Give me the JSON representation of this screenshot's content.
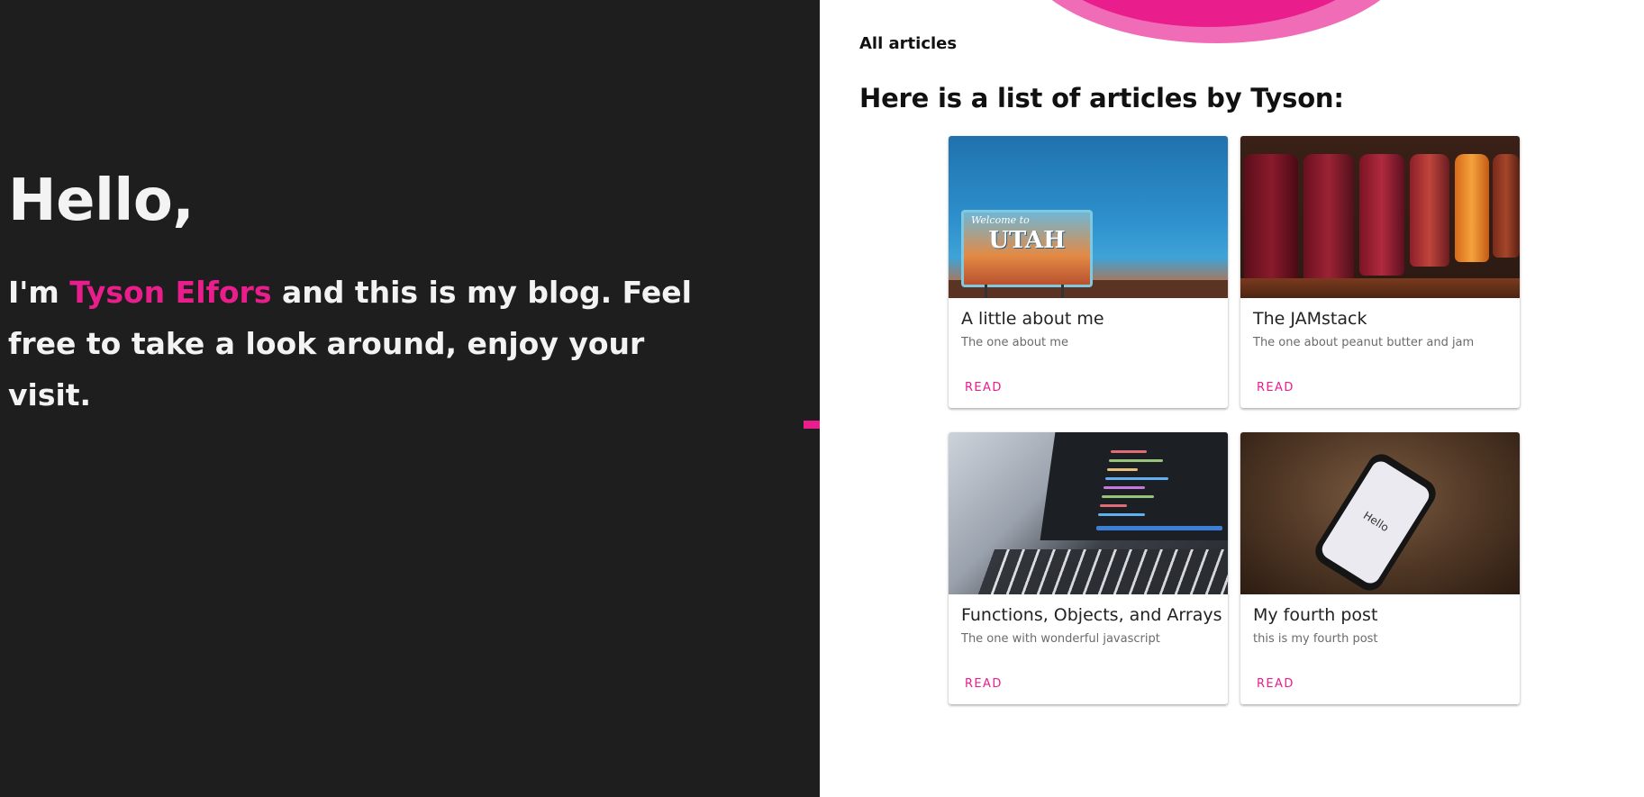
{
  "hero": {
    "title": "Hello,",
    "intro_prefix": "I'm ",
    "name": "Tyson Elfors",
    "intro_suffix": " and this is my blog. Feel free to take a look around, enjoy your visit."
  },
  "nav": {
    "all_articles": "All articles"
  },
  "list": {
    "heading": "Here is a list of articles by Tyson:",
    "cards": [
      {
        "title": "A little about me",
        "subtitle": "The one about me",
        "action": "READ",
        "image": "utah-sign-image"
      },
      {
        "title": "The JAMstack",
        "subtitle": "The one about peanut butter and jam",
        "action": "READ",
        "image": "jam-jars-image"
      },
      {
        "title": "Functions, Objects, and Arrays",
        "subtitle": "The one with wonderful javascript",
        "action": "READ",
        "image": "laptop-code-image"
      },
      {
        "title": "My fourth post",
        "subtitle": "this is my fourth post",
        "action": "READ",
        "image": "phone-hello-image"
      }
    ]
  },
  "image_text": {
    "utah_small": "Welcome to",
    "utah_big": "UTAH",
    "phone": "Hello"
  },
  "colors": {
    "accent": "#e91e8c",
    "hero_bg": "#1e1e1f"
  }
}
